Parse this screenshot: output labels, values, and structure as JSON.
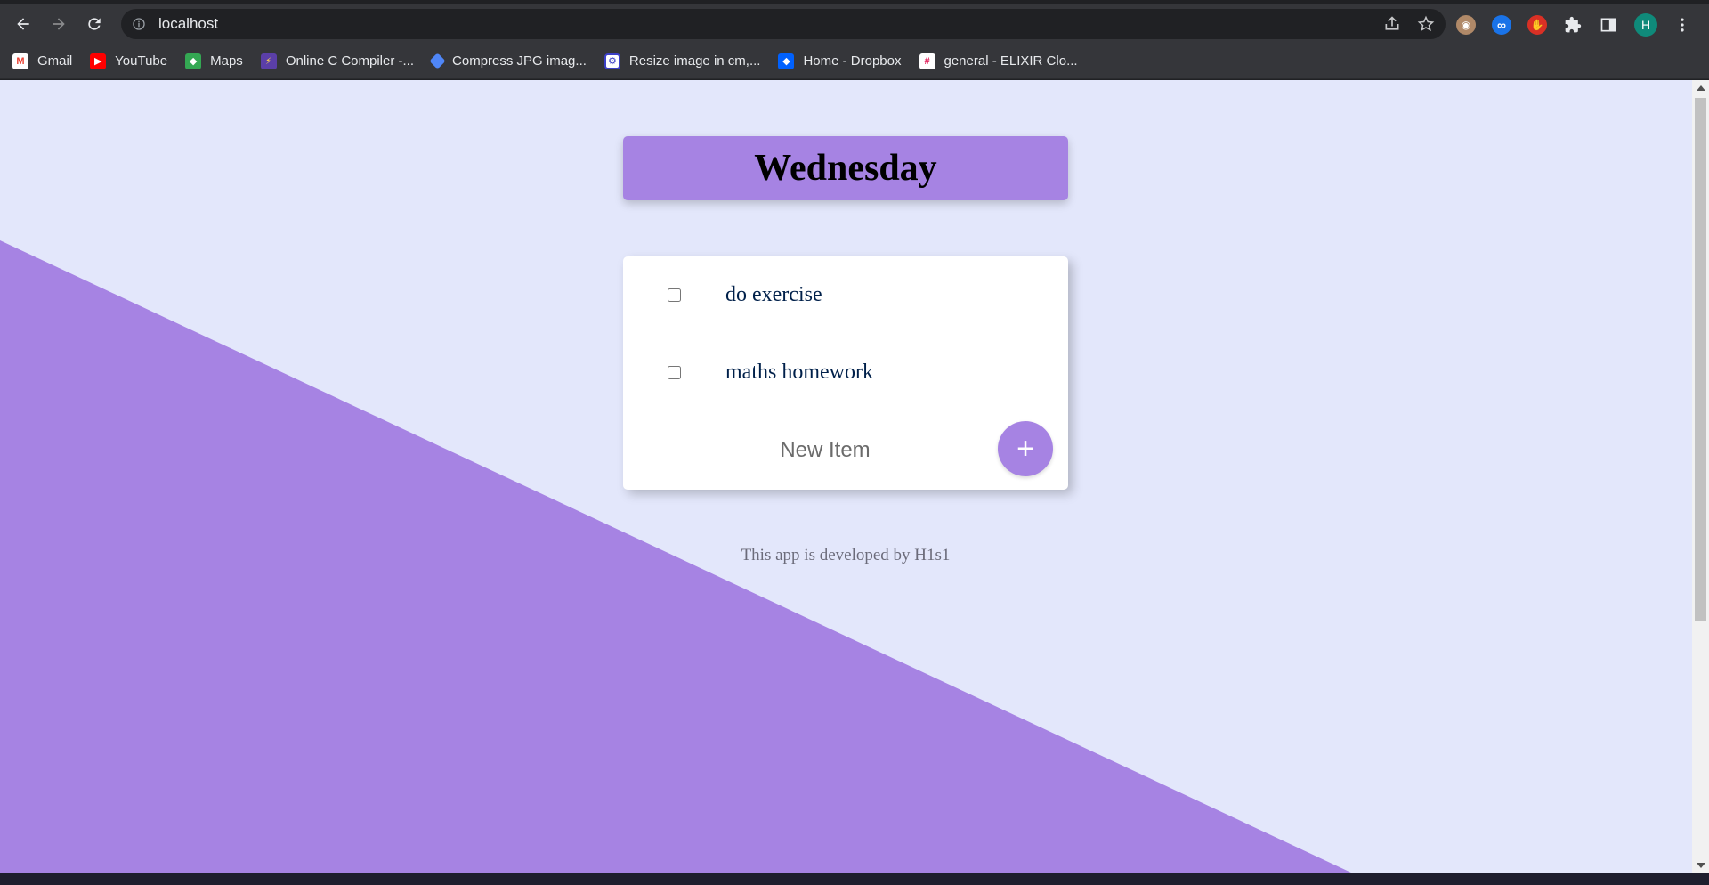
{
  "browser": {
    "url": "localhost",
    "profile_initial": "H",
    "bookmarks": [
      {
        "label": "Gmail",
        "icon": "gmail-icon",
        "glyph": "M"
      },
      {
        "label": "YouTube",
        "icon": "youtube-icon",
        "glyph": "▶"
      },
      {
        "label": "Maps",
        "icon": "maps-icon",
        "glyph": "◆"
      },
      {
        "label": "Online C Compiler -...",
        "icon": "compiler-icon",
        "glyph": "⚡"
      },
      {
        "label": "Compress JPG imag...",
        "icon": "compress-icon",
        "glyph": ""
      },
      {
        "label": "Resize image in cm,...",
        "icon": "resize-icon",
        "glyph": "⚙"
      },
      {
        "label": "Home - Dropbox",
        "icon": "dropbox-icon",
        "glyph": "◆"
      },
      {
        "label": "general - ELIXIR Clo...",
        "icon": "slack-icon",
        "glyph": "#"
      }
    ]
  },
  "app": {
    "title": "Wednesday",
    "items": [
      {
        "text": "do exercise",
        "checked": false
      },
      {
        "text": "maths homework",
        "checked": false
      }
    ],
    "new_item_placeholder": "New Item",
    "add_button_label": "+",
    "footer": "This app is developed by H1s1"
  },
  "colors": {
    "accent": "#a683e3",
    "page_background": "#e3e7fb",
    "card_background": "#ffffff",
    "item_text": "#00204a"
  }
}
